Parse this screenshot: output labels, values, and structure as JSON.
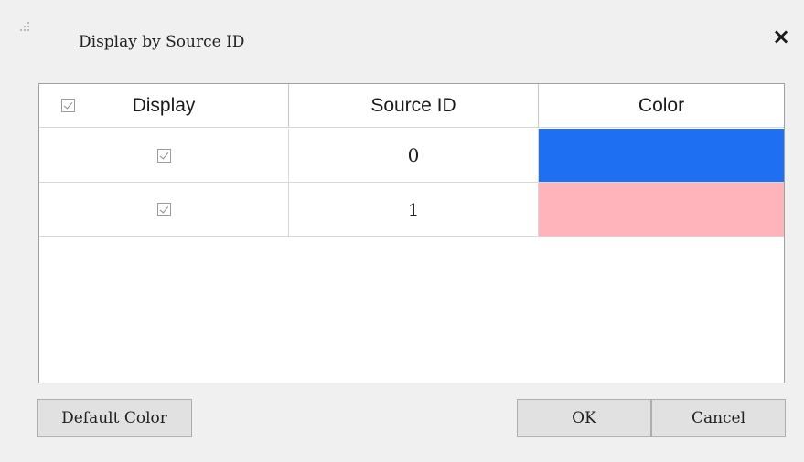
{
  "dialog": {
    "title": "Display by Source ID",
    "close_label": "×"
  },
  "table": {
    "headers": [
      "Display",
      "Source ID",
      "Color"
    ],
    "header_checked": true,
    "rows": [
      {
        "display": true,
        "source_id": "0",
        "color": "#1e6ff2"
      },
      {
        "display": true,
        "source_id": "1",
        "color": "#ffb3bb"
      }
    ]
  },
  "buttons": {
    "default_color": "Default Color",
    "ok": "OK",
    "cancel": "Cancel"
  }
}
